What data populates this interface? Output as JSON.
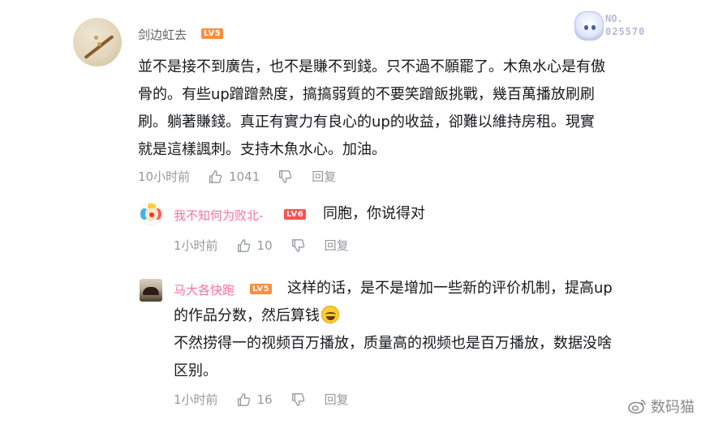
{
  "main_comment": {
    "username": "剑边虹去",
    "level": "LV5",
    "fan_badge": {
      "label": "NO.",
      "number": "025570"
    },
    "text_lines": [
      "並不是接不到廣告，也不是賺不到錢。只不過不願罷了。木魚水心是有傲",
      "骨的。有些up蹭蹭熱度，搞搞弱質的不要笑蹭飯挑戰，幾百萬播放刷刷",
      "刷。躺著賺錢。真正有實力有良心的up的收益，卻難以維持房租。現實",
      "就是這樣諷刺。支持木魚水心。加油。"
    ],
    "time": "10小时前",
    "likes": "1041",
    "reply_label": "回复"
  },
  "replies": [
    {
      "username": "我不知何为败北-",
      "level": "LV6",
      "text_lines": [
        "同胞，你说得对"
      ],
      "time": "1小时前",
      "likes": "10",
      "reply_label": "回复"
    },
    {
      "username": "马大各快跑",
      "level": "LV5",
      "text_lines": [
        "这样的话，是不是增加一些新的评价机制，提高up",
        "的作品分数，然后算钱",
        "不然捞得一的视频百万播放，质量高的视频也是百万播放，数据没啥",
        "区别。"
      ],
      "time": "1小时前",
      "likes": "16",
      "reply_label": "回复"
    }
  ],
  "watermark": "数码猫",
  "colors": {
    "username_gray": "#61666d",
    "username_pink": "#fb7299",
    "meta_gray": "#9499a0",
    "lv5": "#ff8d3a",
    "lv6": "#ff4f4f"
  },
  "icons": [
    "thumb-up-icon",
    "thumb-down-icon",
    "weibo-icon",
    "laughing-emoji-icon"
  ]
}
